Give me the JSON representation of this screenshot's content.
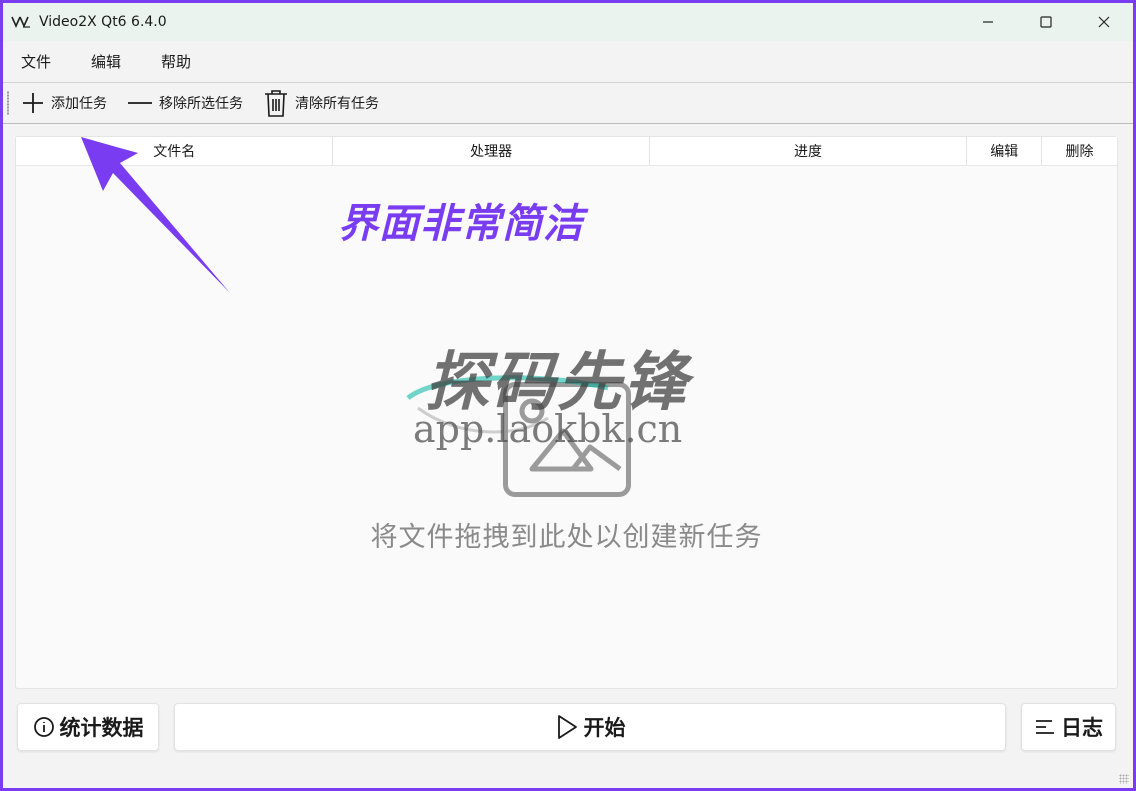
{
  "window": {
    "title": "Video2X Qt6 6.4.0",
    "app_icon": "video2x-logo-icon"
  },
  "menu": [
    "文件",
    "编辑",
    "帮助"
  ],
  "toolbar": {
    "add_task": "添加任务",
    "remove_selected": "移除所选任务",
    "clear_all": "清除所有任务"
  },
  "table": {
    "columns": [
      "文件名",
      "处理器",
      "进度",
      "编辑",
      "删除"
    ],
    "empty_hint": "将文件拖拽到此处以创建新任务"
  },
  "annotation": {
    "text": "界面非常简洁",
    "color": "#7a3cf0"
  },
  "watermark": {
    "brand": "探码先锋",
    "url": "app.laokbk.cn"
  },
  "bottom": {
    "stats": "统计数据",
    "start": "开始",
    "log": "日志"
  },
  "colors": {
    "frame": "#7a3cf0",
    "titlebar": "#eaf3ee"
  }
}
